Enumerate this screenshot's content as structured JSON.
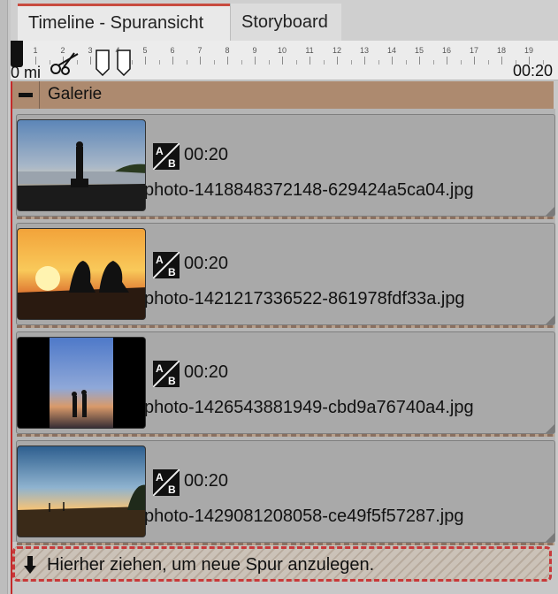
{
  "tabs": [
    {
      "label": "Timeline - Spuransicht",
      "active": true
    },
    {
      "label": "Storyboard",
      "active": false
    }
  ],
  "ruler": {
    "ticks": [
      "1",
      "2",
      "3",
      "4",
      "5",
      "6",
      "7",
      "8",
      "9",
      "10",
      "11",
      "12",
      "13",
      "14",
      "15",
      "16",
      "17",
      "18",
      "19"
    ],
    "left_label": "0 mi",
    "right_label": "00:20"
  },
  "gallery": {
    "title": "Galerie"
  },
  "tracks": [
    {
      "duration": "00:20",
      "filename": "photo-1418848372148-629424a5ca04.jpg",
      "thumb_icon": "sunset-silhouette-photo"
    },
    {
      "duration": "00:20",
      "filename": "photo-1421217336522-861978fdf33a.jpg",
      "thumb_icon": "couple-sunset-photo"
    },
    {
      "duration": "00:20",
      "filename": "photo-1426543881949-cbd9a76740a4.jpg",
      "thumb_icon": "couple-beach-photo"
    },
    {
      "duration": "00:20",
      "filename": "photo-1429081208058-ce49f5f57287.jpg",
      "thumb_icon": "field-sunset-photo"
    }
  ],
  "dropzone": {
    "text": "Hierher ziehen, um neue Spur anzulegen."
  },
  "colors": {
    "gallery_header": "#ad8a6f",
    "dropzone_border": "#c8393a",
    "tab_accent": "#c84b3f"
  }
}
